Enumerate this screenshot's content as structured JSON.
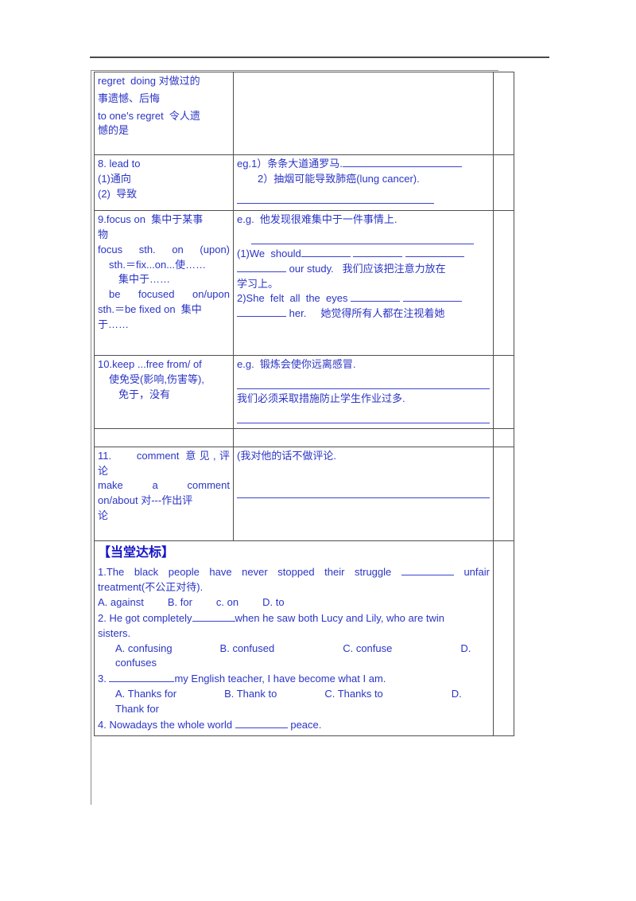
{
  "document": {
    "type": "worksheet",
    "language": "zh-CN/en",
    "text_color": "#2b35c4",
    "heading_color": "#1414c8"
  },
  "table": {
    "rows": [
      {
        "id": "regret-doing",
        "left": {
          "lines": [
            "regret  doing 对做过的",
            "事遗憾、后悔",
            "to one's regret  令人遗",
            "憾的是"
          ]
        },
        "right": {
          "lines": []
        }
      },
      {
        "id": "lead-to",
        "left": {
          "lines": [
            "8. lead to",
            "(1)通向",
            "(2)  导致"
          ]
        },
        "right": {
          "lines": [
            "eg.1）条条大道通罗马.",
            "2）抽烟可能导致肺癌(lung cancer)."
          ]
        }
      },
      {
        "id": "focus-on",
        "left": {
          "lines": [
            "9.focus on  集中于某事",
            "物",
            "focus  sth.  on  (upon)",
            "sth.＝fix...on...使……",
            "集中于……",
            "be  focused  on/upon",
            "sth.＝be fixed on  集中",
            "于……"
          ]
        },
        "right": {
          "lines": [
            "e.g.  他发现很难集中于一件事情上.",
            "(1)We  should",
            "our study.   我们应该把注意力放在",
            "学习上。",
            "2)She  felt  all  the  eyes",
            "her.     她觉得所有人都在注视着她"
          ]
        }
      },
      {
        "id": "keep-free-from",
        "left": {
          "lines": [
            "10.keep ...free from/ of",
            "使免受(影响,伤害等),",
            "免于，没有"
          ]
        },
        "right": {
          "lines": [
            "e.g.  锻炼会使你远离感冒.",
            "我们必须采取措施防止学生作业过多."
          ]
        }
      },
      {
        "id": "spacer",
        "left": {
          "lines": []
        },
        "right": {
          "lines": []
        }
      },
      {
        "id": "comment",
        "left": {
          "lines": [
            "11.    comment 意见,评",
            "论",
            "make    a    comment",
            "on/about 对---作出评",
            "论"
          ]
        },
        "right": {
          "lines": [
            "(我对他的话不做评论."
          ]
        }
      }
    ]
  },
  "exercise": {
    "title": "【当堂达标】",
    "questions": [
      {
        "number": "1.",
        "stem_part1": "1.The  black  people  have  never  stopped  their  struggle",
        "stem_part2": "unfair",
        "stem_line2": "treatment(不公正对待).",
        "options": [
          "A. against",
          "B. for",
          "c. on",
          "D. to"
        ]
      },
      {
        "number": "2.",
        "stem_part1": "2. He got completely",
        "stem_part2": "when he saw both Lucy and Lily, who are twin",
        "stem_line2": "sisters.",
        "options": [
          "A. confusing",
          "B. confused",
          "C. confuse",
          "D. confuses"
        ]
      },
      {
        "number": "3.",
        "stem_part1": "3.",
        "stem_part2": "my English teacher, I have become what I am.",
        "stem_line2": "",
        "options": [
          "A. Thanks for",
          "B. Thank to",
          "C. Thanks to",
          "D. Thank for"
        ]
      },
      {
        "number": "4.",
        "stem_part1": "4. Nowadays the whole world",
        "stem_part2": "peace.",
        "stem_line2": "",
        "options": []
      }
    ]
  }
}
